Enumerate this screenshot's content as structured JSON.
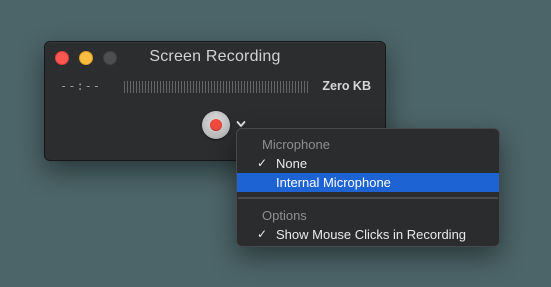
{
  "window": {
    "title": "Screen Recording",
    "time": "--:--",
    "size": "Zero KB"
  },
  "menu": {
    "sections": [
      {
        "header": "Microphone",
        "items": [
          {
            "label": "None",
            "checked": true,
            "highlighted": false
          },
          {
            "label": "Internal Microphone",
            "checked": false,
            "highlighted": true
          }
        ]
      },
      {
        "header": "Options",
        "items": [
          {
            "label": "Show Mouse Clicks in Recording",
            "checked": true,
            "highlighted": false
          }
        ]
      }
    ],
    "check_glyph": "✓"
  },
  "colors": {
    "background": "#4c6569",
    "highlight": "#1d63d4",
    "record": "#f04a3f",
    "close": "#fc5753",
    "minimize": "#fdbc40"
  },
  "icons": {
    "record_button": "record-icon",
    "options_dropdown": "chevron-down-icon"
  }
}
